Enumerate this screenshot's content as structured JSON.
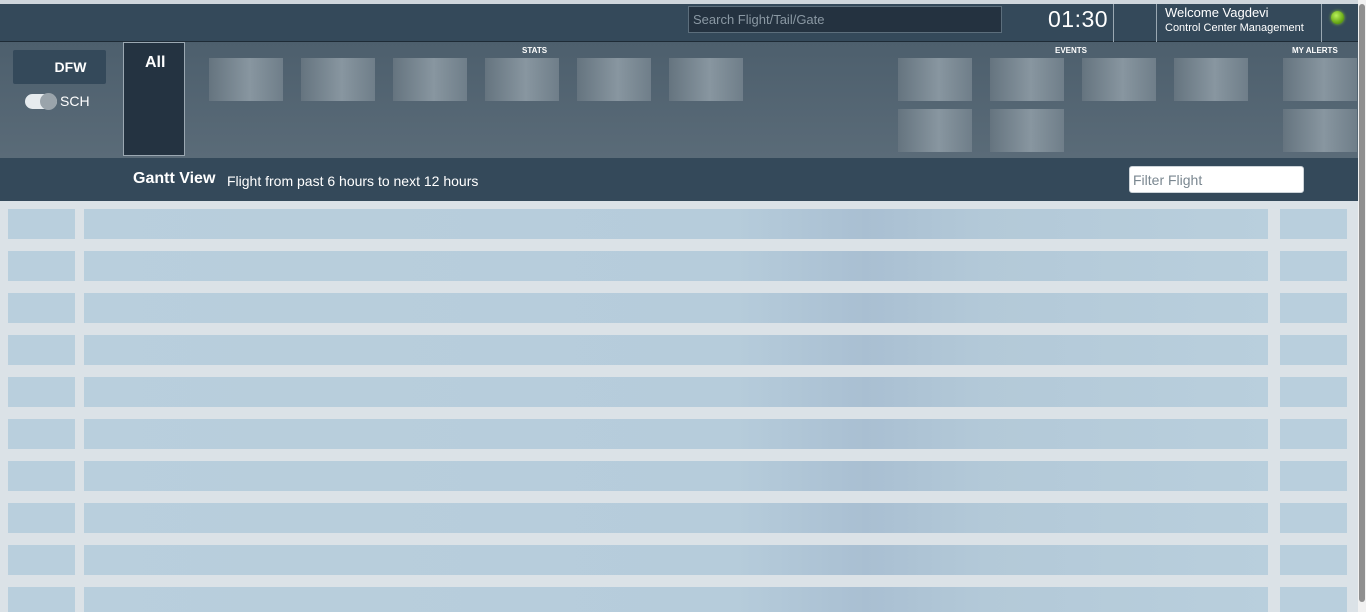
{
  "header": {
    "search_placeholder": "Search Flight/Tail/Gate",
    "clock": "01:30",
    "welcome": "Welcome Vagdevi",
    "role": "Control Center Management",
    "status_color": "#7cc21f"
  },
  "panel": {
    "station": "DFW",
    "toggle_label": "SCH",
    "all_label": "All",
    "sections": {
      "stats": "STATS",
      "events": "EVENTS",
      "alerts": "MY ALERTS"
    }
  },
  "gantt": {
    "title": "Gantt View",
    "subtitle": "Flight from past 6 hours to next 12 hours",
    "filter_placeholder": "Filter Flight"
  }
}
